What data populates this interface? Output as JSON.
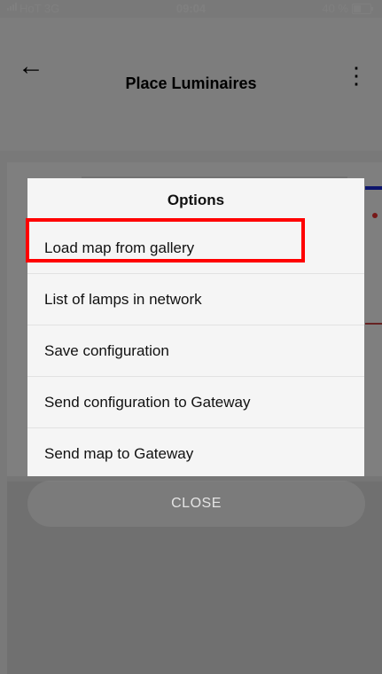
{
  "status_bar": {
    "carrier": "HoT  3G",
    "time": "09:04",
    "battery": "40 %"
  },
  "header": {
    "title": "Place Luminaires",
    "back_icon": "arrow-left-icon",
    "more_icon": "more-vertical-icon"
  },
  "dialog": {
    "title": "Options",
    "options": [
      "Load map from gallery",
      "List of lamps in network",
      "Save configuration",
      "Send configuration to Gateway",
      "Send map to Gateway"
    ]
  },
  "close_label": "CLOSE",
  "colors": {
    "highlight": "#ff0000",
    "overlay": "rgba(0,0,0,0.5)"
  }
}
